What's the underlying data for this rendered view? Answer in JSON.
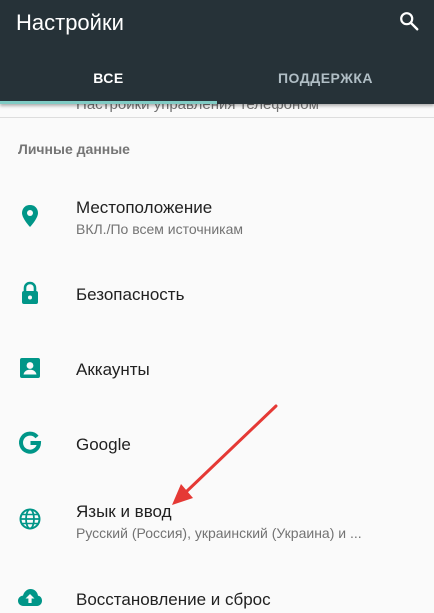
{
  "header": {
    "title": "Настройки"
  },
  "tabs": [
    {
      "label": "ВСЕ",
      "active": true
    },
    {
      "label": "ПОДДЕРЖКА",
      "active": false
    }
  ],
  "cut_off_text": "Настройки управления телефоном",
  "section": {
    "title": "Личные данные"
  },
  "items": [
    {
      "title": "Местоположение",
      "subtitle": "ВКЛ./По всем источникам",
      "icon": "location-pin-icon"
    },
    {
      "title": "Безопасность",
      "icon": "lock-icon"
    },
    {
      "title": "Аккаунты",
      "icon": "account-box-icon"
    },
    {
      "title": "Google",
      "icon": "google-g-icon"
    },
    {
      "title": "Язык и ввод",
      "subtitle": "Русский (Россия), украинский (Украина) и ...",
      "icon": "globe-icon"
    },
    {
      "title": "Восстановление и сброс",
      "icon": "cloud-upload-icon"
    }
  ],
  "colors": {
    "appbar": "#263238",
    "accent": "#009688",
    "tab_indicator": "#80cbc4",
    "annotation_arrow": "#e53935"
  }
}
